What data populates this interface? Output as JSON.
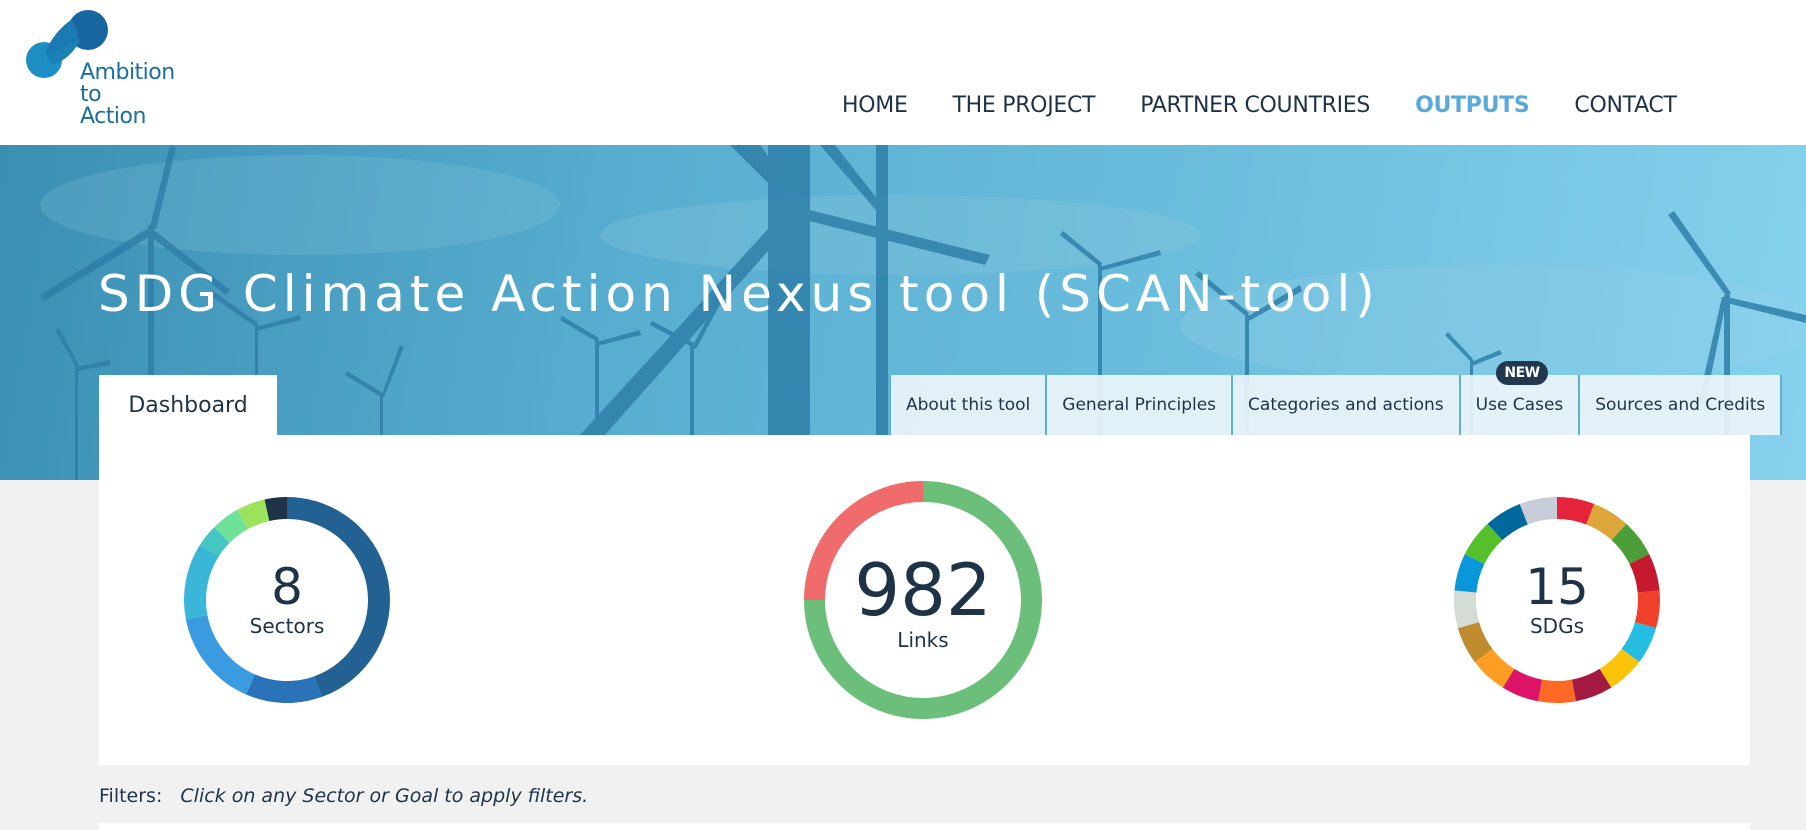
{
  "brand": {
    "logo_lines": [
      "Ambition",
      "to",
      "Action"
    ],
    "logo_color": "#1a6fa0"
  },
  "nav": {
    "items": [
      {
        "label": "HOME",
        "active": false
      },
      {
        "label": "THE PROJECT",
        "active": false
      },
      {
        "label": "PARTNER COUNTRIES",
        "active": false
      },
      {
        "label": "OUTPUTS",
        "active": true
      },
      {
        "label": "CONTACT",
        "active": false
      }
    ],
    "active_color": "#5aaad8"
  },
  "hero": {
    "title": "SDG Climate Action Nexus tool (SCAN-tool)"
  },
  "tabs": {
    "dashboard_label": "Dashboard",
    "items": [
      {
        "label": "About this tool"
      },
      {
        "label": "General Principles"
      },
      {
        "label": "Categories and actions"
      },
      {
        "label": "Use Cases",
        "badge": "NEW"
      },
      {
        "label": "Sources and Credits"
      }
    ]
  },
  "stats": {
    "sectors": {
      "value": "8",
      "label": "Sectors",
      "segments": [
        {
          "share": 0.445,
          "color": "#236192"
        },
        {
          "share": 0.12,
          "color": "#2a73b8"
        },
        {
          "share": 0.155,
          "color": "#3a9be0"
        },
        {
          "share": 0.12,
          "color": "#39b6d8"
        },
        {
          "share": 0.035,
          "color": "#45c6c0"
        },
        {
          "share": 0.045,
          "color": "#6fe09a"
        },
        {
          "share": 0.045,
          "color": "#9be35a"
        },
        {
          "share": 0.035,
          "color": "#1f3347"
        }
      ]
    },
    "links": {
      "value": "982",
      "label": "Links",
      "segments": [
        {
          "share": 0.75,
          "color": "#6cbf7a"
        },
        {
          "share": 0.25,
          "color": "#f06b6b"
        }
      ]
    },
    "sdgs": {
      "value": "15",
      "label": "SDGs",
      "segments": [
        {
          "share": 0.0667,
          "color": "#e5243b"
        },
        {
          "share": 0.0667,
          "color": "#dda63a"
        },
        {
          "share": 0.0667,
          "color": "#4c9f38"
        },
        {
          "share": 0.0667,
          "color": "#c5192d"
        },
        {
          "share": 0.0667,
          "color": "#ef402b"
        },
        {
          "share": 0.0667,
          "color": "#26bde2"
        },
        {
          "share": 0.0667,
          "color": "#fcc30b"
        },
        {
          "share": 0.0667,
          "color": "#a21942"
        },
        {
          "share": 0.0667,
          "color": "#fd6925"
        },
        {
          "share": 0.0667,
          "color": "#dd1367"
        },
        {
          "share": 0.0667,
          "color": "#fd9d24"
        },
        {
          "share": 0.0667,
          "color": "#bf8b2e"
        },
        {
          "share": 0.0667,
          "color": "#d5dcd5"
        },
        {
          "share": 0.0667,
          "color": "#0a97d9"
        },
        {
          "share": 0.0667,
          "color": "#56c02b"
        },
        {
          "share": 0.0667,
          "color": "#00689d"
        },
        {
          "share": 0.0667,
          "color": "#c9cdd9"
        }
      ]
    }
  },
  "filters": {
    "label": "Filters:",
    "hint": "Click on any Sector or Goal to apply filters."
  }
}
